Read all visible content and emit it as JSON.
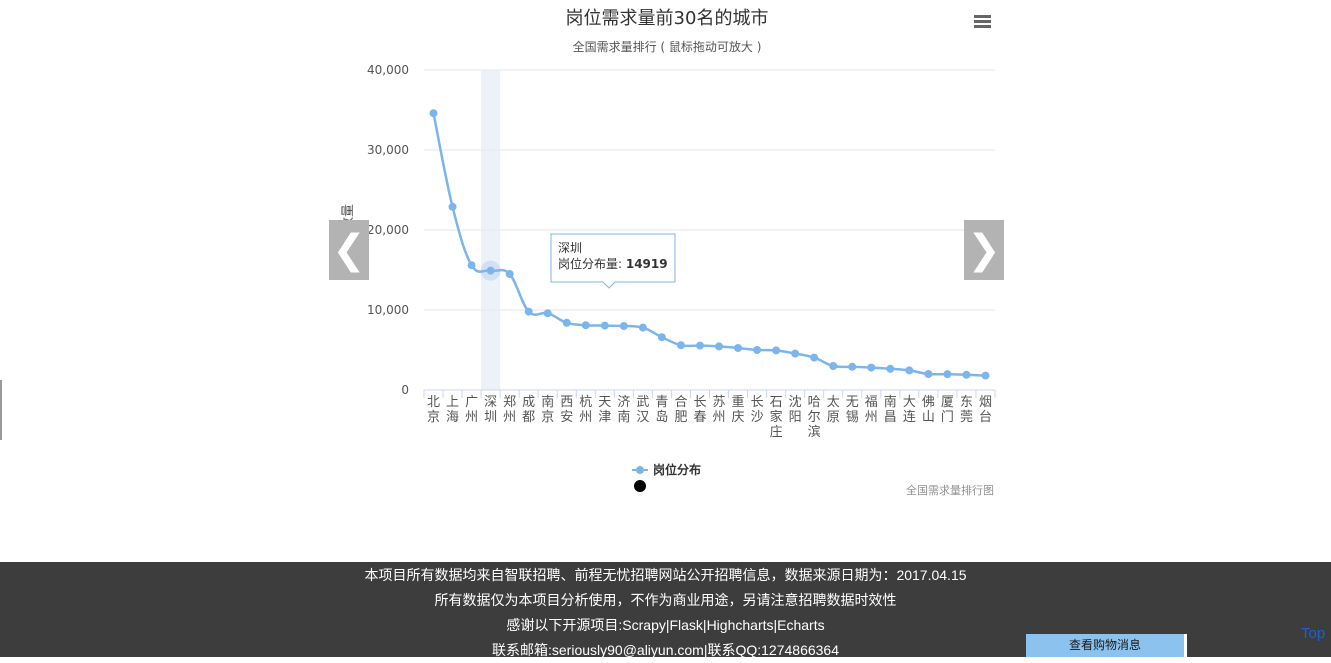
{
  "chart_data": {
    "type": "line",
    "title": "岗位需求量前30名的城市",
    "subtitle": "全国需求量排行 ( 鼠标拖动可放大 )",
    "ylabel": "分布数量",
    "xlabel": "",
    "ylim": [
      0,
      40000
    ],
    "y_ticks": [
      "0",
      "10,000",
      "20,000",
      "30,000",
      "40,000"
    ],
    "y_tick_values": [
      0,
      10000,
      20000,
      30000,
      40000
    ],
    "grid": true,
    "legend_position": "bottom",
    "categories": [
      "北京",
      "上海",
      "广州",
      "深圳",
      "郑州",
      "成都",
      "南京",
      "西安",
      "杭州",
      "天津",
      "济南",
      "武汉",
      "青岛",
      "合肥",
      "长春",
      "苏州",
      "重庆",
      "长沙",
      "石家庄",
      "沈阳",
      "哈尔滨",
      "太原",
      "无锡",
      "福州",
      "南昌",
      "大连",
      "佛山",
      "厦门",
      "东莞",
      "烟台"
    ],
    "series": [
      {
        "name": "岗位分布",
        "color": "#7cb5ec",
        "values": [
          34600,
          22900,
          15600,
          14919,
          14500,
          9800,
          9600,
          8400,
          8100,
          8050,
          8000,
          7800,
          6600,
          5600,
          5550,
          5450,
          5250,
          5000,
          4950,
          4550,
          4050,
          3000,
          2900,
          2800,
          2650,
          2450,
          2000,
          1980,
          1900,
          1800
        ]
      }
    ],
    "highlight_category": "深圳",
    "tooltip": {
      "category": "深圳",
      "series_label": "岗位分布量: ",
      "value": "14919"
    },
    "credits": "全国需求量排行图"
  },
  "icons": {
    "menu": "menu-icon",
    "prev": "chevron-left-icon",
    "next": "chevron-right-icon"
  },
  "nav": {
    "prev_glyph": "❮",
    "next_glyph": "❯"
  },
  "footer": {
    "lines": [
      "本项目所有数据均来自智联招聘、前程无忧招聘网站公开招聘信息，数据来源日期为：2017.04.15",
      "所有数据仅为本项目分析使用，不作为商业用途，另请注意招聘数据时效性",
      "感谢以下开源项目:Scrapy|Flask|Highcharts|Echarts",
      "联系邮箱:seriously90@aliyun.com|联系QQ:1274866364"
    ]
  },
  "cart_button_label": "查看购物消息",
  "top_link_label": "Top"
}
